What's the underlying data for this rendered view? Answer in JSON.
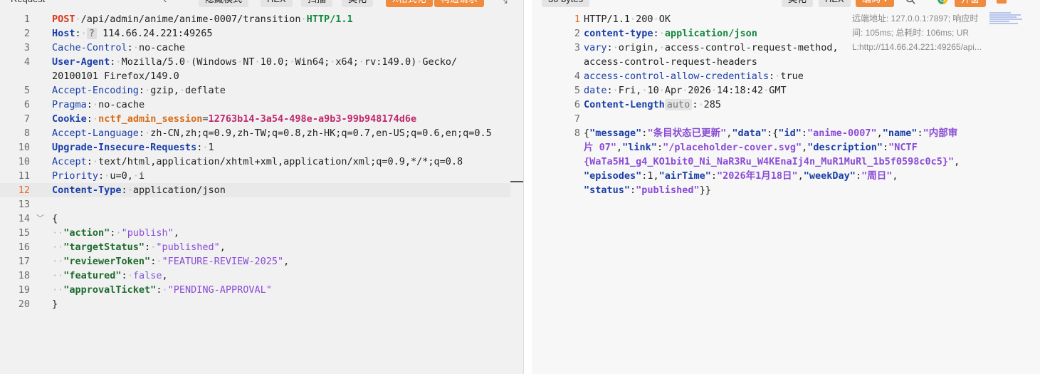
{
  "request": {
    "toolbar": {
      "title": "Request",
      "prev_icon": "‹",
      "btn_hide": "隐藏模式",
      "btn_hex": "HEX",
      "btn_expand": "扫描",
      "btn_convert": "美化",
      "btn_orange1": "X格式化",
      "btn_orange2": "构造请求",
      "expand_icon": "⤡"
    },
    "lines": [
      {
        "n": "1",
        "method": "POST",
        "path": "/api/admin/anime/anime-0007/transition",
        "proto": "HTTP/1.1"
      },
      {
        "n": "2",
        "name": "Host",
        "chip": "?",
        "value": "114.66.24.221:49265"
      },
      {
        "n": "3",
        "name": "Cache-Control",
        "value": "no-cache"
      },
      {
        "n": "4",
        "name": "User-Agent",
        "value": "Mozilla/5.0 (Windows NT 10.0; Win64; x64; rv:149.0) Gecko/"
      },
      {
        "n": "",
        "cont": "20100101 Firefox/149.0"
      },
      {
        "n": "5",
        "name": "Accept-Encoding",
        "value": "gzip, deflate"
      },
      {
        "n": "6",
        "name": "Pragma",
        "value": "no-cache"
      },
      {
        "n": "7",
        "name": "Cookie",
        "ckey": "nctf_admin_session",
        "cval": "12763b14-3a54-498e-a9b3-99b948174d6e"
      },
      {
        "n": "8",
        "name": "Accept-Language",
        "value": "zh-CN,zh;q=0.9,zh-TW;q=0.8,zh-HK;q=0.7,en-US;q=0.6,en;q=0.5"
      },
      {
        "n": "10",
        "name": "Upgrade-Insecure-Requests",
        "value": "1"
      },
      {
        "n": "10",
        "name": "Accept",
        "value": "text/html,application/xhtml+xml,application/xml;q=0.9,*/*;q=0.8"
      },
      {
        "n": "11",
        "name": "Priority",
        "value": "u=0, i"
      },
      {
        "n": "12",
        "name": "Content-Type",
        "value": "application/json",
        "active": true
      },
      {
        "n": "13"
      },
      {
        "n": "14",
        "brace": "{"
      },
      {
        "n": "15",
        "key": "\"action\"",
        "val": "\"publish\"",
        "tail": ","
      },
      {
        "n": "16",
        "key": "\"targetStatus\"",
        "val": "\"published\"",
        "tail": ","
      },
      {
        "n": "17",
        "key": "\"reviewerToken\"",
        "val": "\"FEATURE-REVIEW-2025\"",
        "tail": ","
      },
      {
        "n": "18",
        "key": "\"featured\"",
        "val": "false",
        "tail": ","
      },
      {
        "n": "19",
        "key": "\"approvalTicket\"",
        "val": "\"PENDING-APPROVAL\"",
        "tail": ""
      },
      {
        "n": "20",
        "brace": "}"
      }
    ]
  },
  "response": {
    "toolbar": {
      "size": "30 bytes",
      "btn_convert": "美化",
      "btn_hex": "HEX",
      "btn_orange": "编码 ▾",
      "btn_ok": "开窗"
    },
    "lines": [
      {
        "n": "1",
        "text": "HTTP/1.1 200 OK",
        "active": true
      },
      {
        "n": "2",
        "name": "content-type",
        "value": "application/json",
        "bold": true
      },
      {
        "n": "3",
        "name": "vary",
        "value": "origin, access-control-request-method,"
      },
      {
        "n": "",
        "cont": "access-control-request-headers"
      },
      {
        "n": "4",
        "name": "access-control-allow-credentials",
        "value": "true"
      },
      {
        "n": "5",
        "name": "date",
        "value": "Fri, 10 Apr 2026 14:18:42 GMT"
      },
      {
        "n": "6",
        "name": "Content-Length",
        "chip": "auto",
        "value": "285",
        "boldname": true
      },
      {
        "n": "7"
      },
      {
        "n": "8",
        "json": 1
      },
      {
        "n": "",
        "json": 2
      },
      {
        "n": "",
        "json": 3
      },
      {
        "n": "",
        "json": 4
      },
      {
        "n": "",
        "json": 5
      }
    ],
    "json": {
      "message_key": "\"message\"",
      "message_val": "\"条目状态已更新\"",
      "data_key": "\"data\"",
      "id_key": "\"id\"",
      "id_val": "\"anime-0007\"",
      "name_key": "\"name\"",
      "name_val_a": "\"内部审",
      "name_val_b": "片 07\"",
      "link_key": "\"link\"",
      "link_val": "\"/placeholder-cover.svg\"",
      "desc_key": "\"description\"",
      "desc_val_a": "\"NCTF",
      "desc_val_b": "{WaTa5H1_g4_KO1bit0_Ni_NaR3Ru_W4KEnaIj4n_MuR1MuRl_1b5f0598c0c5}\"",
      "episodes_key": "\"episodes\"",
      "episodes_val": "1",
      "airtime_key": "\"airTime\"",
      "airtime_val": "\"2026年1月18日\"",
      "weekday_key": "\"weekDay\"",
      "weekday_val": "\"周日\"",
      "status_key": "\"status\"",
      "status_val": "\"published\""
    },
    "info": {
      "line1": "远端地址: 127.0.0.1:7897; 响应时",
      "line2": "间: 105ms; 总耗时: 106ms; UR",
      "line3": "L:http://114.66.24.221:49265/api..."
    }
  },
  "colors": {
    "accent": "#f08a3c",
    "header_name": "#1a3fa8",
    "method": "#d9361c",
    "json_string": "#8a4cd6"
  }
}
